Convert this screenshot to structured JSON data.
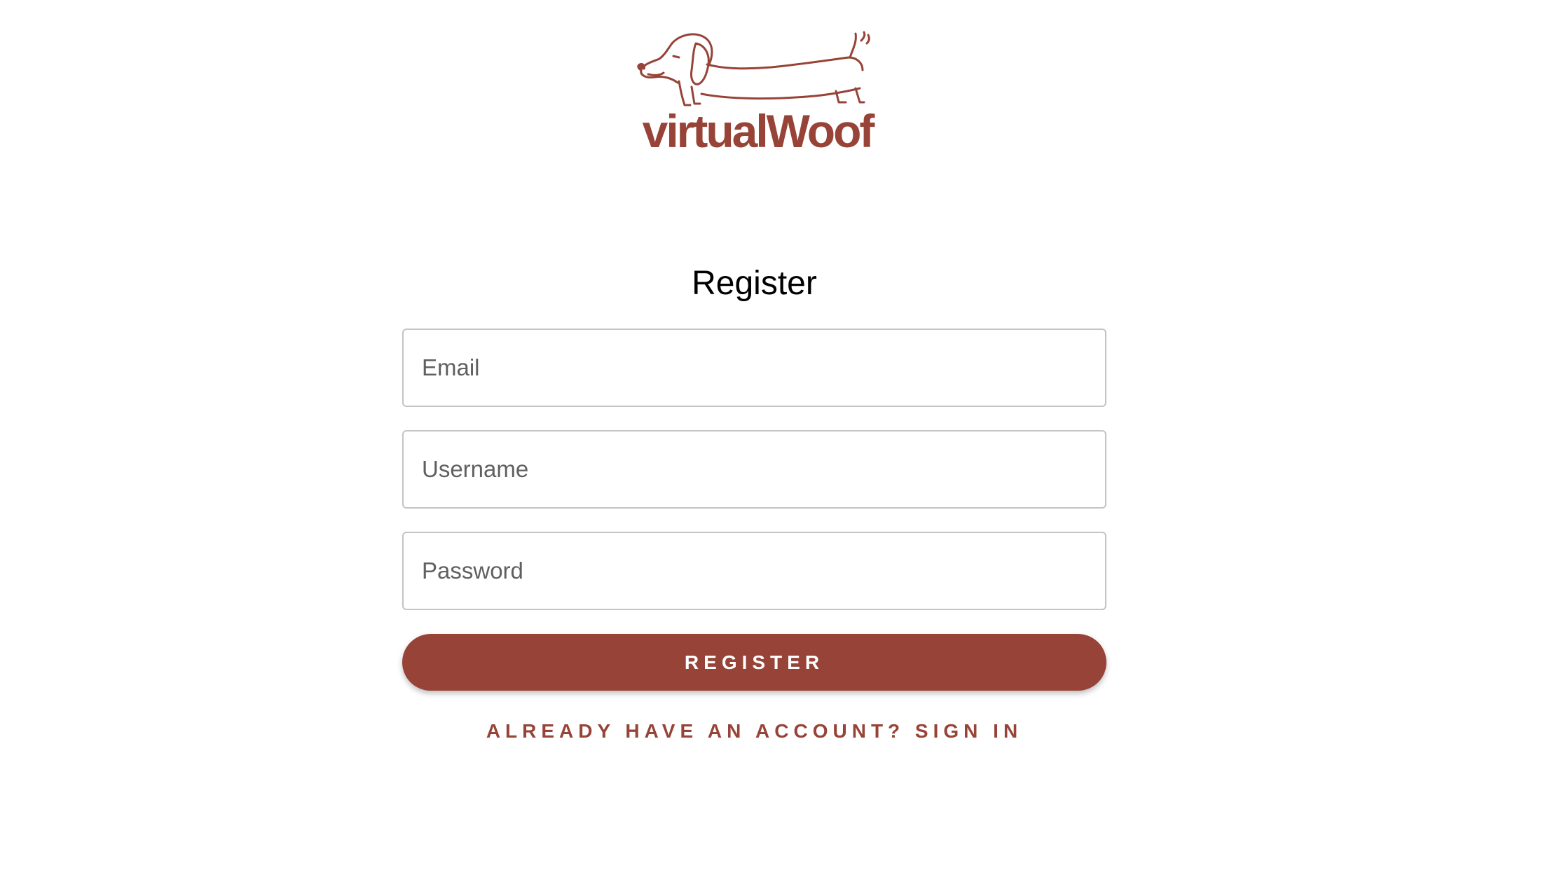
{
  "colors": {
    "brand": "#974337",
    "field_border": "#c4c4c4",
    "placeholder": "#606060"
  },
  "logo": {
    "text": "virtualWoof",
    "icon": "dachshund-icon"
  },
  "form": {
    "title": "Register",
    "fields": [
      {
        "name": "email",
        "placeholder": "Email",
        "value": ""
      },
      {
        "name": "username",
        "placeholder": "Username",
        "value": ""
      },
      {
        "name": "password",
        "placeholder": "Password",
        "value": ""
      }
    ],
    "submit_label": "REGISTER",
    "signin_link": "ALREADY HAVE AN ACCOUNT? SIGN IN"
  }
}
